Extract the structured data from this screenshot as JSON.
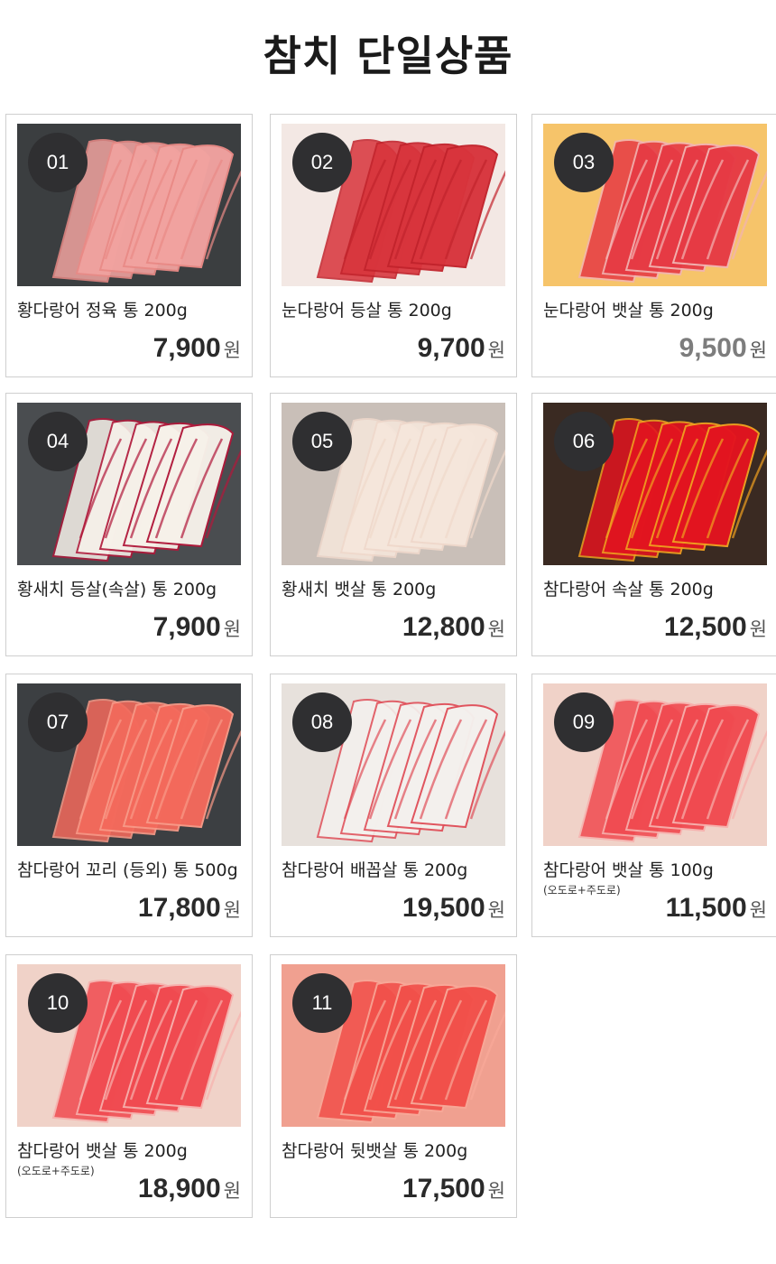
{
  "page": {
    "title": "참치 단일상품"
  },
  "currency": "원",
  "products": [
    {
      "num": "01",
      "name": "황다랑어 정육 통 200g",
      "sub": "",
      "price": "7,900",
      "bg": "#3b3e40",
      "flesh": "#f2a3a0",
      "accent": "#e98a86"
    },
    {
      "num": "02",
      "name": "눈다랑어 등살 통 200g",
      "sub": "",
      "price": "9,700",
      "bg": "#f3e8e4",
      "flesh": "#d8343c",
      "accent": "#c2232c"
    },
    {
      "num": "03",
      "name": "눈다랑어 뱃살 통 200g",
      "sub": "",
      "price": "9,500",
      "bg": "#f6c46a",
      "flesh": "#e63a44",
      "accent": "#f2b4b2"
    },
    {
      "num": "04",
      "name": "황새치 등살(속살) 통 200g",
      "sub": "",
      "price": "7,900",
      "bg": "#4a4d50",
      "flesh": "#f7f2ea",
      "accent": "#b0183a"
    },
    {
      "num": "05",
      "name": "황새치 뱃살 통 200g",
      "sub": "",
      "price": "12,800",
      "bg": "#c9bfb8",
      "flesh": "#f6e7dc",
      "accent": "#efd8cb"
    },
    {
      "num": "06",
      "name": "참다랑어 속살 통 200g",
      "sub": "",
      "price": "12,500",
      "bg": "#3a2a22",
      "flesh": "#e3141f",
      "accent": "#f0a020"
    },
    {
      "num": "07",
      "name": "참다랑어 꼬리 (등외) 통 500g",
      "sub": "",
      "price": "17,800",
      "bg": "#3c3f42",
      "flesh": "#f46a5c",
      "accent": "#f89a88"
    },
    {
      "num": "08",
      "name": "참다랑어 배꼽살 통 200g",
      "sub": "",
      "price": "19,500",
      "bg": "#e7e1dc",
      "flesh": "#f4f1ee",
      "accent": "#e0505a"
    },
    {
      "num": "09",
      "name": "참다랑어 뱃살 통 100g",
      "sub": "(오도로+주도로)",
      "price": "11,500",
      "bg": "#f0d2c8",
      "flesh": "#f04a50",
      "accent": "#f7b0ad"
    },
    {
      "num": "10",
      "name": "참다랑어 뱃살 통 200g",
      "sub": "(오도로+주도로)",
      "price": "18,900",
      "bg": "#f0d2c8",
      "flesh": "#f04a50",
      "accent": "#f7b0ad"
    },
    {
      "num": "11",
      "name": "참다랑어 뒷뱃살 통 200g",
      "sub": "",
      "price": "17,500",
      "bg": "#f0a090",
      "flesh": "#f2504a",
      "accent": "#f8a898"
    }
  ]
}
